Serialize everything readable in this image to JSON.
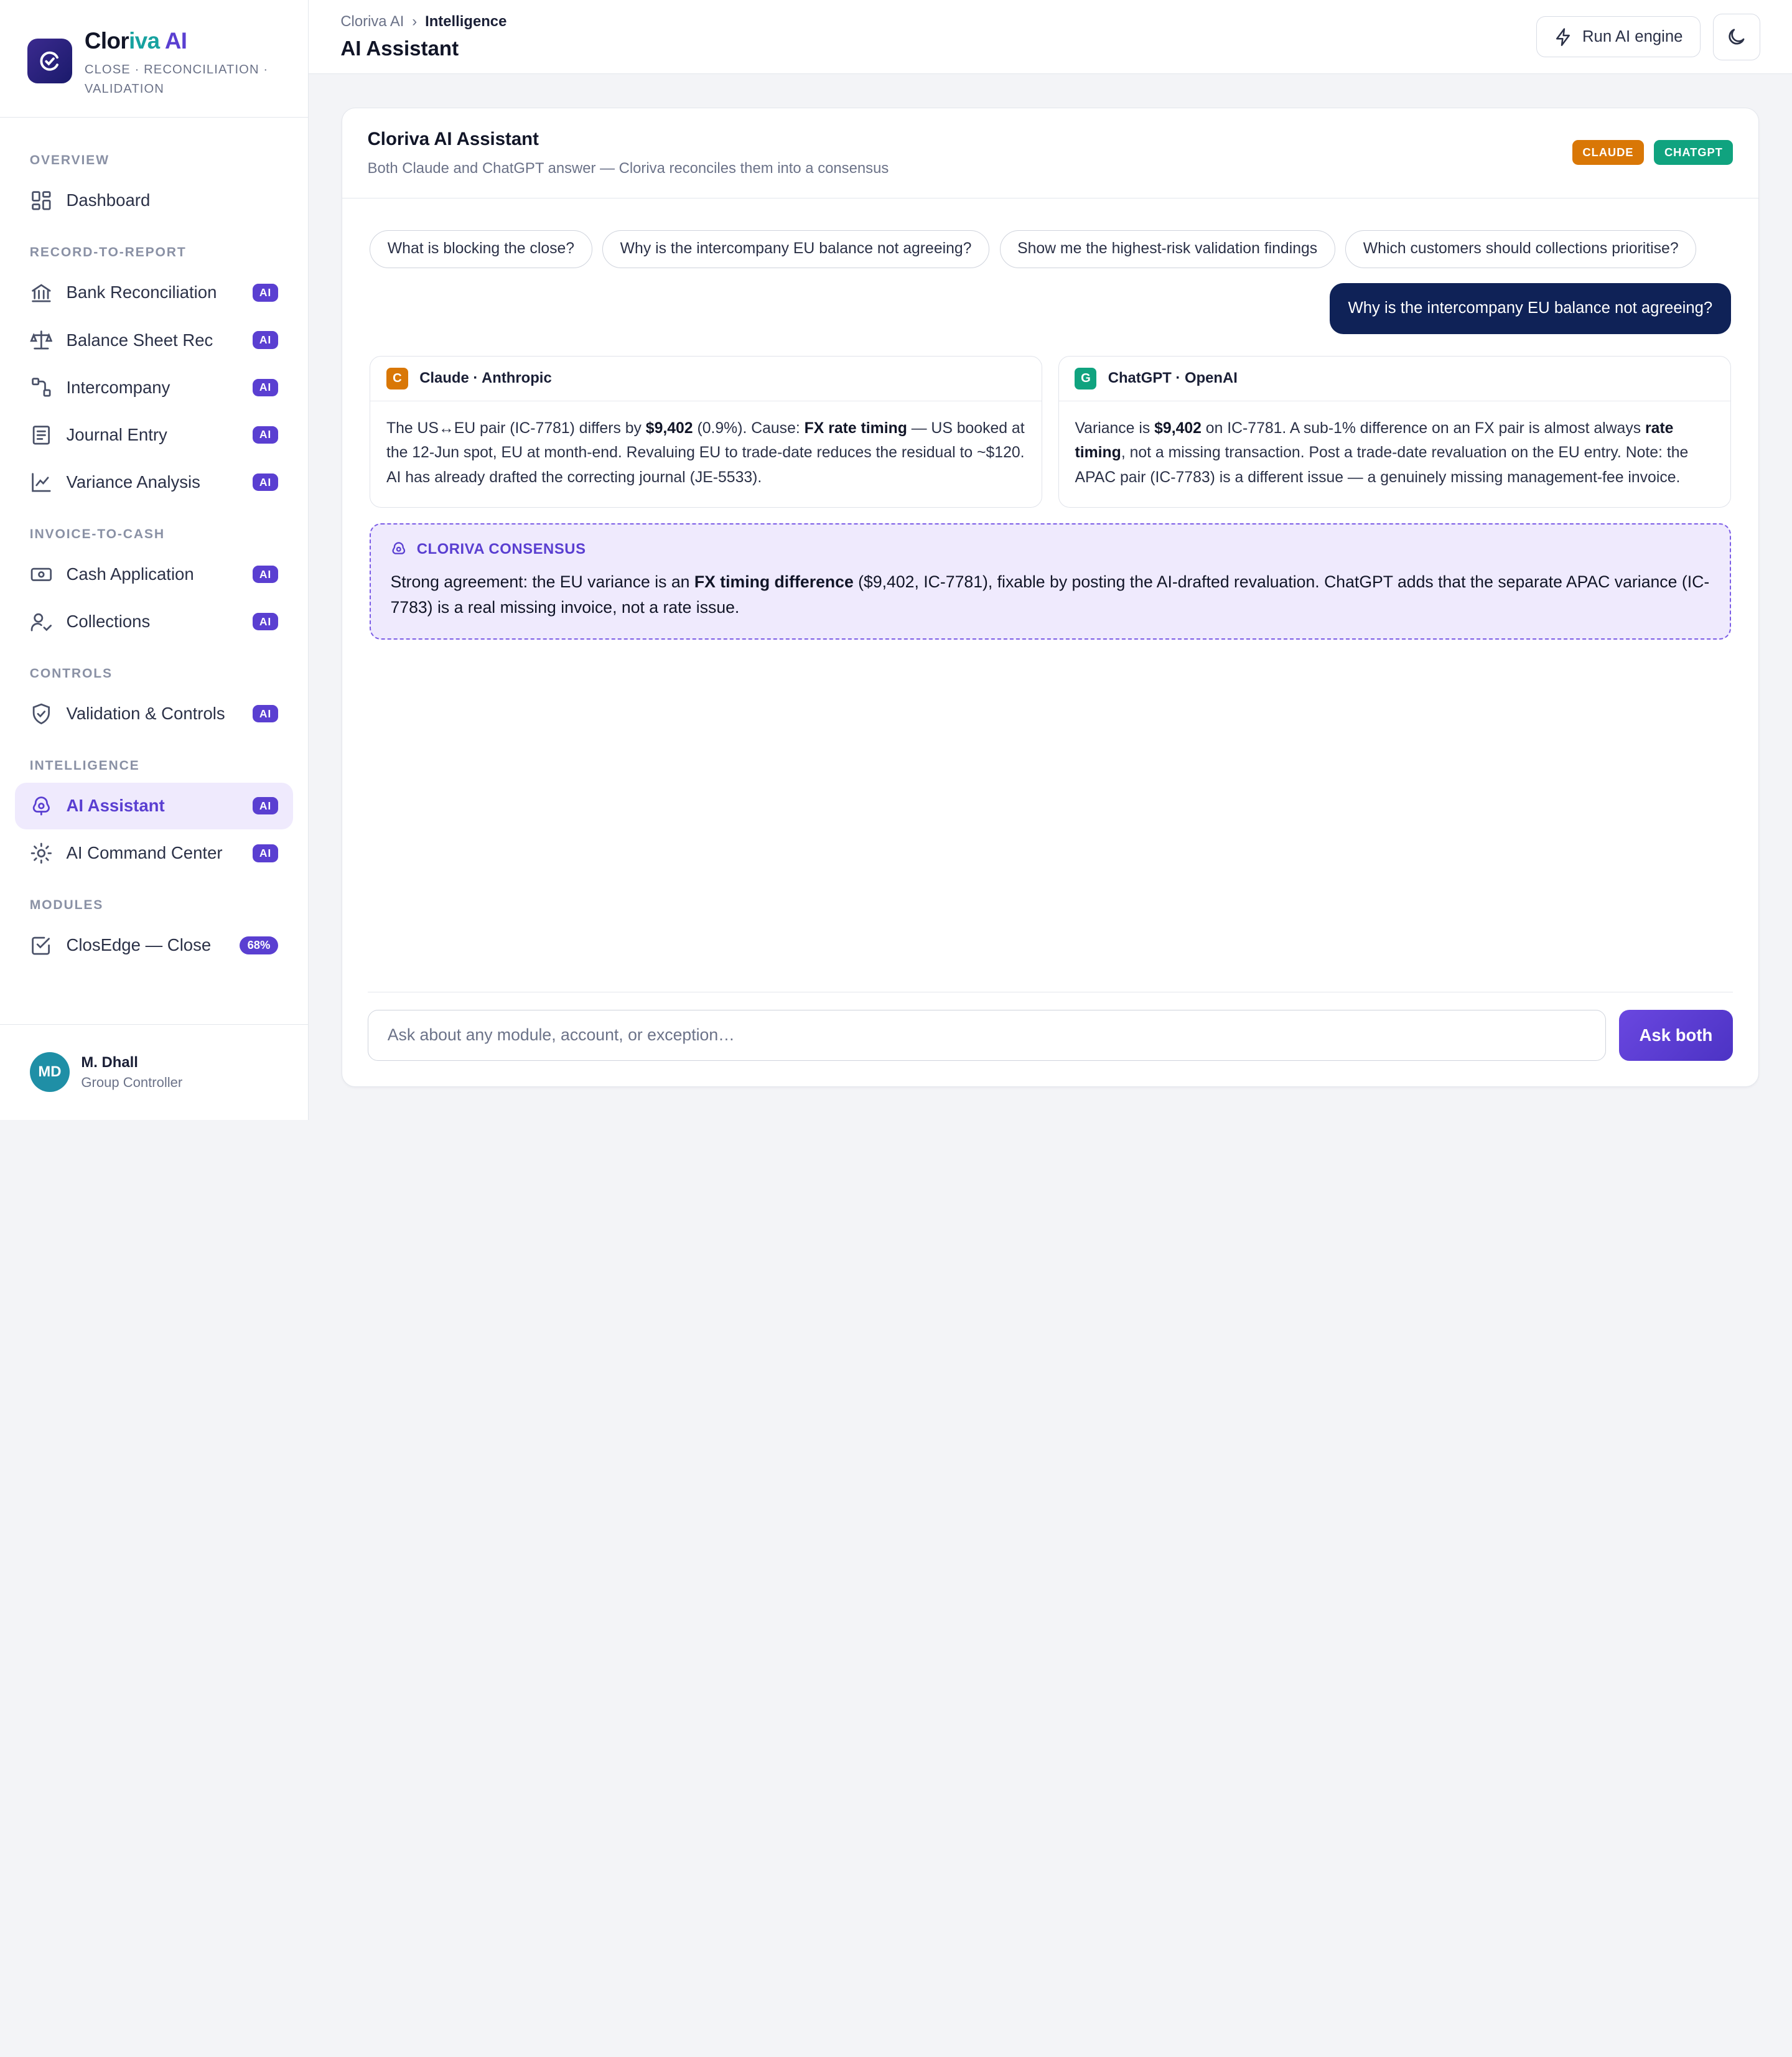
{
  "brand": {
    "name_part1": "Clor",
    "name_part2": "iva",
    "name_part3": " AI",
    "subtitle": "CLOSE · RECONCILIATION · VALIDATION"
  },
  "nav": {
    "sections": {
      "overview": "OVERVIEW",
      "r2r": "RECORD-TO-REPORT",
      "i2c": "INVOICE-TO-CASH",
      "controls": "CONTROLS",
      "intelligence": "INTELLIGENCE",
      "modules": "MODULES"
    },
    "items": {
      "dashboard": "Dashboard",
      "bank_rec": "Bank Reconciliation",
      "bs_rec": "Balance Sheet Rec",
      "intercompany": "Intercompany",
      "journal": "Journal Entry",
      "variance": "Variance Analysis",
      "cash_app": "Cash Application",
      "collections": "Collections",
      "validation": "Validation & Controls",
      "ai_assistant": "AI Assistant",
      "ai_command": "AI Command Center",
      "closedge": "ClosEdge — Close"
    },
    "ai_badge": "AI",
    "closedge_progress": "68%"
  },
  "user": {
    "initials": "MD",
    "name": "M. Dhall",
    "role": "Group Controller"
  },
  "topbar": {
    "breadcrumb_root": "Cloriva AI",
    "breadcrumb_sep": "›",
    "breadcrumb_current": "Intelligence",
    "title": "AI Assistant",
    "run_button": "Run AI engine"
  },
  "assistant": {
    "title": "Cloriva AI Assistant",
    "subtitle": "Both Claude and ChatGPT answer — Cloriva reconciles them into a consensus",
    "tag_claude": "CLAUDE",
    "tag_chatgpt": "CHATGPT",
    "suggestions": [
      "What is blocking the close?",
      "Why is the intercompany EU balance not agreeing?",
      "Show me the highest-risk validation findings",
      "Which customers should collections prioritise?"
    ],
    "user_message": "Why is the intercompany EU balance not agreeing?",
    "claude": {
      "avatar": "C",
      "name": "Claude · Anthropic",
      "t1": "The US↔EU pair (IC-7781) differs by ",
      "b1": "$9,402",
      "t2": " (0.9%). Cause: ",
      "b2": "FX rate timing",
      "t3": " — US booked at the 12-Jun spot, EU at month-end. Revaluing EU to trade-date reduces the residual to ~$120. AI has already drafted the correcting journal (JE-5533)."
    },
    "chatgpt": {
      "avatar": "G",
      "name": "ChatGPT · OpenAI",
      "t1": "Variance is ",
      "b1": "$9,402",
      "t2": " on IC-7781. A sub-1% difference on an FX pair is almost always ",
      "b2": "rate timing",
      "t3": ", not a missing transaction. Post a trade-date revaluation on the EU entry. Note: the APAC pair (IC-7783) is a different issue — a genuinely missing management-fee invoice."
    },
    "consensus": {
      "label": "CLORIVA CONSENSUS",
      "t1": "Strong agreement: the EU variance is an ",
      "b1": "FX timing difference",
      "t2": " ($9,402, IC-7781), fixable by posting the AI-drafted revaluation. ChatGPT adds that the separate APAC variance (IC-7783) is a real missing invoice, not a rate issue."
    },
    "input_placeholder": "Ask about any module, account, or exception…",
    "ask_button": "Ask both"
  },
  "colors": {
    "accent": "#5a3fd1",
    "claude": "#d97706",
    "chatgpt": "#10a37f",
    "user_bubble": "#0f2257"
  }
}
